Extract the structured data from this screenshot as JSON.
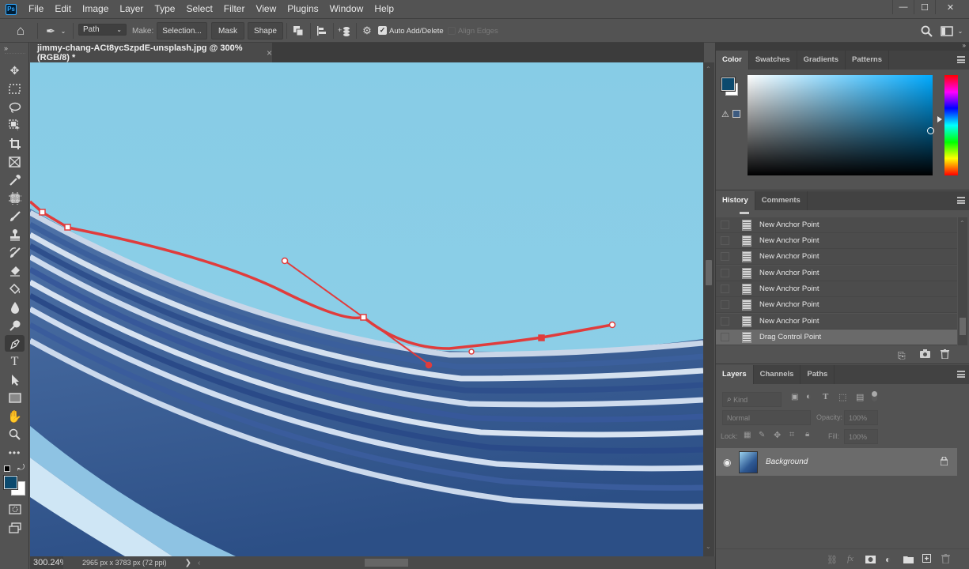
{
  "app": {
    "logo": "Ps"
  },
  "menu": [
    "File",
    "Edit",
    "Image",
    "Layer",
    "Type",
    "Select",
    "Filter",
    "View",
    "Plugins",
    "Window",
    "Help"
  ],
  "window_controls": {
    "minimize": "—",
    "maximize": "☐",
    "close": "✕"
  },
  "options_bar": {
    "home_icon": "⌂",
    "tool_icon": "✒",
    "mode_value": "Path",
    "make_label": "Make:",
    "selection_button": "Selection...",
    "mask_button": "Mask",
    "shape_button": "Shape",
    "auto_add_delete_label": "Auto Add/Delete",
    "auto_add_delete_checked": true,
    "align_edges_label": "Align Edges",
    "align_edges_checked": false
  },
  "document": {
    "tab_title": "jimmy-chang-ACt8ycSzpdE-unsplash.jpg @ 300% (RGB/8) *",
    "close_glyph": "×",
    "zoom": "300.24%",
    "info": "2965 px x 3783 px (72 ppi)",
    "info_arrow": "❯",
    "path_color": "#e03c3c"
  },
  "tools": [
    "move",
    "marquee",
    "lasso",
    "object-select",
    "crop",
    "frame",
    "eyedropper",
    "spot-heal",
    "brush",
    "clone-stamp",
    "history-brush",
    "eraser",
    "paint-bucket",
    "blur",
    "dodge",
    "pen",
    "type",
    "path-select",
    "rectangle",
    "hand",
    "zoom",
    "more"
  ],
  "colors": {
    "foreground": "#0c4a6e",
    "background": "#ffffff"
  },
  "color_panel": {
    "tabs": [
      "Color",
      "Swatches",
      "Gradients",
      "Patterns"
    ],
    "active": "Color",
    "hue_color": "#00aaff"
  },
  "history_panel": {
    "tabs": [
      "History",
      "Comments"
    ],
    "active": "History",
    "items": [
      "New Anchor Point",
      "New Anchor Point",
      "New Anchor Point",
      "New Anchor Point",
      "New Anchor Point",
      "New Anchor Point",
      "New Anchor Point",
      "Drag Control Point"
    ],
    "selected_index": 7
  },
  "layers_panel": {
    "tabs": [
      "Layers",
      "Channels",
      "Paths"
    ],
    "active": "Layers",
    "kind_placeholder": "Kind",
    "blend_mode": "Normal",
    "opacity_label": "Opacity:",
    "opacity_value": "100%",
    "lock_label": "Lock:",
    "fill_label": "Fill:",
    "fill_value": "100%",
    "layers": [
      {
        "name": "Background",
        "visible": true,
        "locked": true
      }
    ]
  }
}
